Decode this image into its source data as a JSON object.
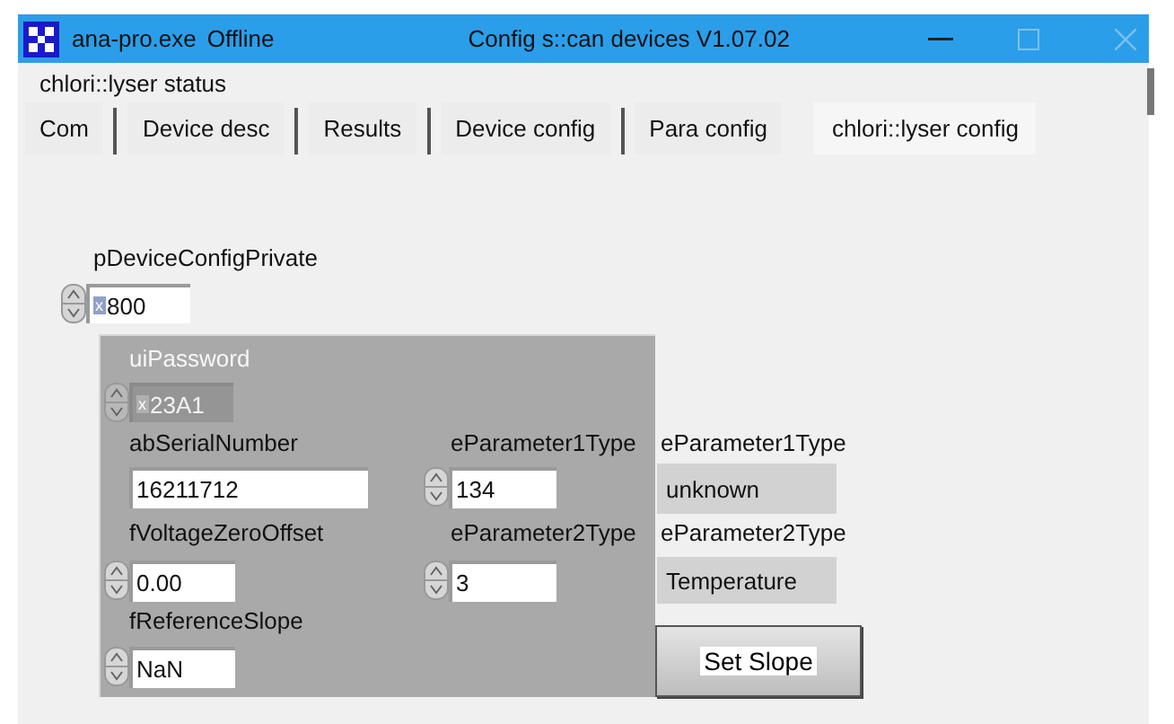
{
  "window": {
    "app_name": "ana-pro.exe",
    "status": "Offline",
    "title": "Config s::can devices V1.07.02"
  },
  "status_label": "chlori::lyser status",
  "tabs": [
    {
      "label": "Com",
      "selected": false
    },
    {
      "label": "Device desc",
      "selected": false
    },
    {
      "label": "Results",
      "selected": false
    },
    {
      "label": "Device config",
      "selected": false
    },
    {
      "label": "Para config",
      "selected": false
    },
    {
      "label": "chlori::lyser config",
      "selected": true
    }
  ],
  "controls": [
    {
      "label": "pDeviceConfigPrivate",
      "kind": "numeric",
      "radix": "x",
      "value": "800",
      "disabled": false
    },
    {
      "label": "uiPassword",
      "kind": "numeric",
      "radix": "x",
      "value": "23A1",
      "disabled": true
    },
    {
      "label": "abSerialNumber",
      "kind": "text",
      "value": "16211712",
      "disabled": false
    },
    {
      "label": "fVoltageZeroOffset",
      "kind": "numeric",
      "value": "0.00",
      "disabled": false
    },
    {
      "label": "fReferenceSlope",
      "kind": "numeric",
      "value": "NaN",
      "disabled": false
    },
    {
      "label": "eParameter1Type",
      "kind": "numeric",
      "value": "134",
      "disabled": false
    },
    {
      "label": "eParameter2Type",
      "kind": "numeric",
      "value": "3",
      "disabled": false
    },
    {
      "label": "eParameter1Type",
      "kind": "indicator",
      "value": "unknown"
    },
    {
      "label": "eParameter2Type",
      "kind": "indicator",
      "value": "Temperature"
    }
  ],
  "button": "Set Slope"
}
